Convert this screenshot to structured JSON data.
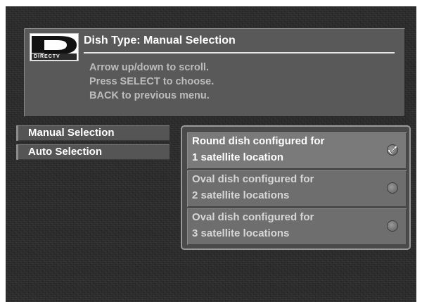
{
  "header": {
    "logo_text": "DIRECTV",
    "title": "Dish Type: Manual Selection",
    "instructions": [
      "Arrow up/down to scroll.",
      "Press SELECT to choose.",
      "BACK to previous menu."
    ]
  },
  "menu": {
    "items": [
      {
        "label": "Manual Selection"
      },
      {
        "label": "Auto Selection"
      }
    ]
  },
  "options": [
    {
      "line1": "Round dish configured for",
      "line2": "1 satellite location",
      "selected": true
    },
    {
      "line1": "Oval dish configured for",
      "line2": "2 satellite locations",
      "selected": false
    },
    {
      "line1": "Oval dish configured for",
      "line2": "3 satellite locations",
      "selected": false
    }
  ],
  "icons": {
    "logo": "directv-logo-icon",
    "selected": "check-mark-icon",
    "unselected": "radio-empty-icon"
  }
}
